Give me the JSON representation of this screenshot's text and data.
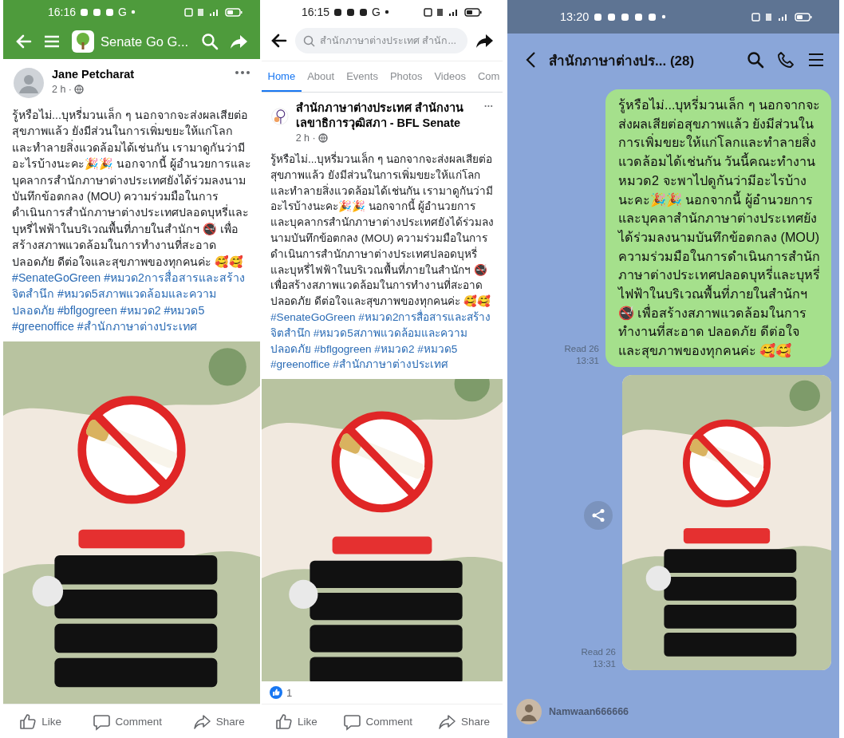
{
  "left_screen": {
    "status_bar": {
      "time": "16:16",
      "letter": "G"
    },
    "toolbar": {
      "title": "Senate Go G..."
    },
    "post": {
      "author": "Jane Petcharat",
      "time": "2 h ·",
      "text": "รู้หรือไม่...บุหรี่มวนเล็ก ๆ นอกจากจะส่งผลเสียต่อสุขภาพแล้ว ยังมีส่วนในการเพิ่มขยะให้แก่โลกและทำลายสิ่งแวดล้อมได้เช่นกัน เรามาดูกันว่ามีอะไรบ้างนะคะ🎉🎉 นอกจากนี้ ผู้อำนวยการและบุคลากรสำนักภาษาต่างประเทศยังได้ร่วมลงนามบันทึกข้อตกลง (MOU) ความร่วมมือในการดำเนินการสำนักภาษาต่างประเทศปลอดบุหรี่และบุหรี่ไฟฟ้าในบริเวณพื้นที่ภายในสำนักฯ 🚭 เพื่อสร้างสภาพแวดล้อมในการทำงานที่สะอาด ปลอดภัย ดีต่อใจและสุขภาพของทุกคนค่ะ 🥰🥰",
      "hashtags": "#SenateGoGreen #หมวด2การสื่อสารและสร้างจิตสำนึก #หมวด5สภาพแวดล้อมและความปลอดภัย #bflgogreen #หมวด2 #หมวด5 #greenoffice #สำนักภาษาต่างประเทศ"
    },
    "actions": [
      {
        "label": "Like",
        "kind": "like"
      },
      {
        "label": "Comment",
        "kind": "comment"
      },
      {
        "label": "Share",
        "kind": "share"
      }
    ]
  },
  "middle_screen": {
    "status_bar": {
      "time": "16:15",
      "letter": "G"
    },
    "search": {
      "placeholder": "สำนักภาษาต่างประเทศ สำนัก..."
    },
    "tabs": [
      {
        "label": "Home",
        "selected": true
      },
      {
        "label": "About",
        "selected": false
      },
      {
        "label": "Events",
        "selected": false
      },
      {
        "label": "Photos",
        "selected": false
      },
      {
        "label": "Videos",
        "selected": false
      },
      {
        "label": "Com",
        "selected": false
      }
    ],
    "post": {
      "author": "สำนักภาษาต่างประเทศ สำนักงาน เลขาธิการวุฒิสภา - BFL Senate",
      "time": "2 h ·",
      "text": "รู้หรือไม่...บุหรี่มวนเล็ก ๆ นอกจากจะส่งผลเสียต่อสุขภาพแล้ว ยังมีส่วนในการเพิ่มขยะให้แก่โลกและทำลายสิ่งแวดล้อมได้เช่นกัน เรามาดูกันว่ามีอะไรบ้างนะคะ🎉🎉 นอกจากนี้ ผู้อำนวยการและบุคลากรสำนักภาษาต่างประเทศยังได้ร่วมลงนามบันทึกข้อตกลง (MOU) ความร่วมมือในการดำเนินการสำนักภาษาต่างประเทศปลอดบุหรี่และบุหรี่ไฟฟ้าในบริเวณพื้นที่ภายในสำนักฯ 🚭 เพื่อสร้างสภาพแวดล้อมในการทำงานที่สะอาด ปลอดภัย ดีต่อใจและสุขภาพของทุกคนค่ะ 🥰🥰",
      "hashtags": "#SenateGoGreen #หมวด2การสื่อสารและสร้างจิตสำนึก #หมวด5สภาพแวดล้อมและความปลอดภัย #bflgogreen #หมวด2 #หมวด5 #greenoffice #สำนักภาษาต่างประเทศ"
    },
    "reactions": {
      "count": "1"
    },
    "actions": [
      {
        "label": "Like",
        "kind": "like"
      },
      {
        "label": "Comment",
        "kind": "comment"
      },
      {
        "label": "Share",
        "kind": "share"
      }
    ]
  },
  "chat_screen": {
    "status_bar": {
      "time": "13:20"
    },
    "header": {
      "title": "สำนักภาษาต่างปร... (28)"
    },
    "messages": [
      {
        "kind": "text",
        "text": "รู้หรือไม่...บุหรี่มวนเล็ก ๆ นอกจากจะส่งผลเสียต่อสุขภาพแล้ว ยังมีส่วนในการเพิ่มขยะให้แก่โลกและทำลายสิ่งแวดล้อมได้เช่นกัน วันนี้คณะทำงานหมวด2 จะพาไปดูกันว่ามีอะไรบ้างนะคะ🎉🎉 นอกจากนี้ ผู้อำนวยการและบุคลาสำนักภาษาต่างประเทศยังได้ร่วมลงนามบันทึกข้อตกลง (MOU) ความร่วมมือในการดำเนินการสำนักภาษาต่างประเทศปลอดบุหรี่และบุหรี่ไฟฟ้าในบริเวณพื้นที่ภายในสำนักฯ 🚭 เพื่อสร้างสภาพแวดล้อมในการทำงานที่สะอาด ปลอดภัย ดีต่อใจและสุขภาพของทุกคนค่ะ 🥰🥰",
        "receipt": "Read 26",
        "receipt_time": "13:31"
      },
      {
        "receipt": "Read 26",
        "receipt_time": "13:31"
      }
    ],
    "sender": {
      "name": "Namwaan666666"
    }
  }
}
